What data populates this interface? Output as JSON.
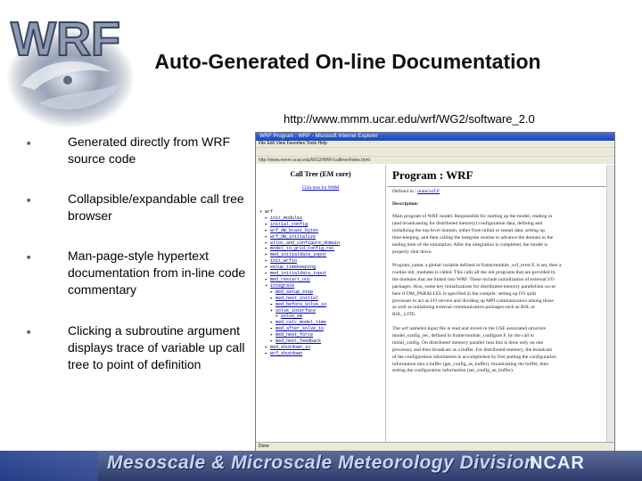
{
  "logo": {
    "text": "WRF"
  },
  "title": "Auto-Generated On-line Documentation",
  "url": "http://www.mmm.ucar.edu/wrf/WG2/software_2.0",
  "bullets": [
    "Generated directly from WRF source code",
    "Collapsible/expandable call tree browser",
    "Man-page-style hypertext documentation from in-line code commentary",
    "Clicking a subroutine argument displays trace of variable up call tree to point of definition"
  ],
  "browser": {
    "window_title": "WRF Program : WRF - Microsoft Internet Explorer",
    "menu": "File  Edit  View  Favorites  Tools  Help",
    "address": "http://www.mmm.ucar.edu/WG2/WRF/calltree/index.html",
    "status": "Done",
    "call_tree": {
      "title": "Call Tree (EM core)",
      "link": "Click here for NMM",
      "rows": [
        {
          "indent": 0,
          "mark": "▾",
          "text": "wrf",
          "link": false
        },
        {
          "indent": 1,
          "mark": "▸",
          "text": "init_modules",
          "link": true
        },
        {
          "indent": 1,
          "mark": "▸",
          "text": "initial_config",
          "link": true
        },
        {
          "indent": 1,
          "mark": "▸",
          "text": "wrf_dm_bcast_bytes",
          "link": true
        },
        {
          "indent": 1,
          "mark": "▸",
          "text": "wrf_dm_initialize",
          "link": true
        },
        {
          "indent": 1,
          "mark": "▸",
          "text": "alloc_and_configure_domain",
          "link": true
        },
        {
          "indent": 1,
          "mark": "▸",
          "text": "model_to_grid_config_rec",
          "link": true
        },
        {
          "indent": 1,
          "mark": "▸",
          "text": "med_initialdata_input",
          "link": true
        },
        {
          "indent": 1,
          "mark": "▸",
          "text": "init_wrfio",
          "link": true
        },
        {
          "indent": 1,
          "mark": "▸",
          "text": "setup_timekeeping",
          "link": true
        },
        {
          "indent": 1,
          "mark": "▸",
          "text": "med_initialdata_input",
          "link": true
        },
        {
          "indent": 1,
          "mark": "▸",
          "text": "med_restart_out",
          "link": true
        },
        {
          "indent": 1,
          "mark": "▾",
          "text": "integrate",
          "link": true
        },
        {
          "indent": 2,
          "mark": "▸",
          "text": "med_setup_step",
          "link": true
        },
        {
          "indent": 2,
          "mark": "▸",
          "text": "med_nest_initial",
          "link": true
        },
        {
          "indent": 2,
          "mark": "▸",
          "text": "med_before_solve_io",
          "link": true
        },
        {
          "indent": 2,
          "mark": "▾",
          "text": "solve_interface",
          "link": true
        },
        {
          "indent": 3,
          "mark": "▸",
          "text": "solve_em",
          "link": true
        },
        {
          "indent": 2,
          "mark": "▸",
          "text": "med_calc_model_time",
          "link": true
        },
        {
          "indent": 2,
          "mark": "▸",
          "text": "med_after_solve_io",
          "link": true
        },
        {
          "indent": 2,
          "mark": "▸",
          "text": "med_nest_force",
          "link": true
        },
        {
          "indent": 2,
          "mark": "▸",
          "text": "med_nest_feedback",
          "link": true
        },
        {
          "indent": 1,
          "mark": "▸",
          "text": "med_shutdown_io",
          "link": true
        },
        {
          "indent": 1,
          "mark": "▸",
          "text": "wrf_shutdown",
          "link": true
        }
      ]
    },
    "doc": {
      "heading": "Program : WRF",
      "defined_label": "Defined in :",
      "defined_file": "main/wrf.F",
      "description_label": "Description:",
      "p1": [
        "Main program of WRF model. Responsible for starting up the model, reading in",
        "(and broadcasting for distributed memory) configuration data, defining and",
        "initializing the top-level domain, either from initial or restart data, setting up",
        "time-keeping, and then calling the integrate routine to advance the domain to the",
        "ending time of the simulation. After the integration is completed, the model is",
        "properly shut down."
      ],
      "p2": [
        "Program_name, a global variable defined in frame/module_wrf_error.F, is set, then a",
        "routine init_modules is called. This calls all the init programs that are provided by",
        "the modules that are linked into WRF. These include initialization of external I/O",
        "packages. Also, some key initializations for distributed-memory parallelism occur",
        "here if DM_PARALLEL is specified in the compile: setting up I/O quilt",
        "processes to act as I/O servers and dividing up MPI communicators among those",
        "as well as initializing external communication packages such as RSL or",
        "RSL_LITE."
      ],
      "p3": [
        "The wrf namelist.input file is read and stored in the USE associated structure",
        "model_config_rec, defined in frame/module_configure.F, by the call to",
        "initial_config. On distributed memory parallel runs this is done only on one",
        "processor, and then broadcast as a buffer. For distributed-memory, the broadcast",
        "of the configuration information is accomplished by first putting the configuration",
        "information into a buffer (get_config_as_buffer), broadcasting the buffer, then",
        "setting the configuration information (set_config_as_buffer)."
      ]
    }
  },
  "footer": {
    "division": "Mesoscale & Microscale Meteorology Division",
    "org": "NCAR"
  },
  "colors": {
    "footer_top": "#5b6c9a",
    "footer_bottom": "#2d3c6c",
    "link": "#0000cc",
    "titlebar": "#1a45b8"
  }
}
